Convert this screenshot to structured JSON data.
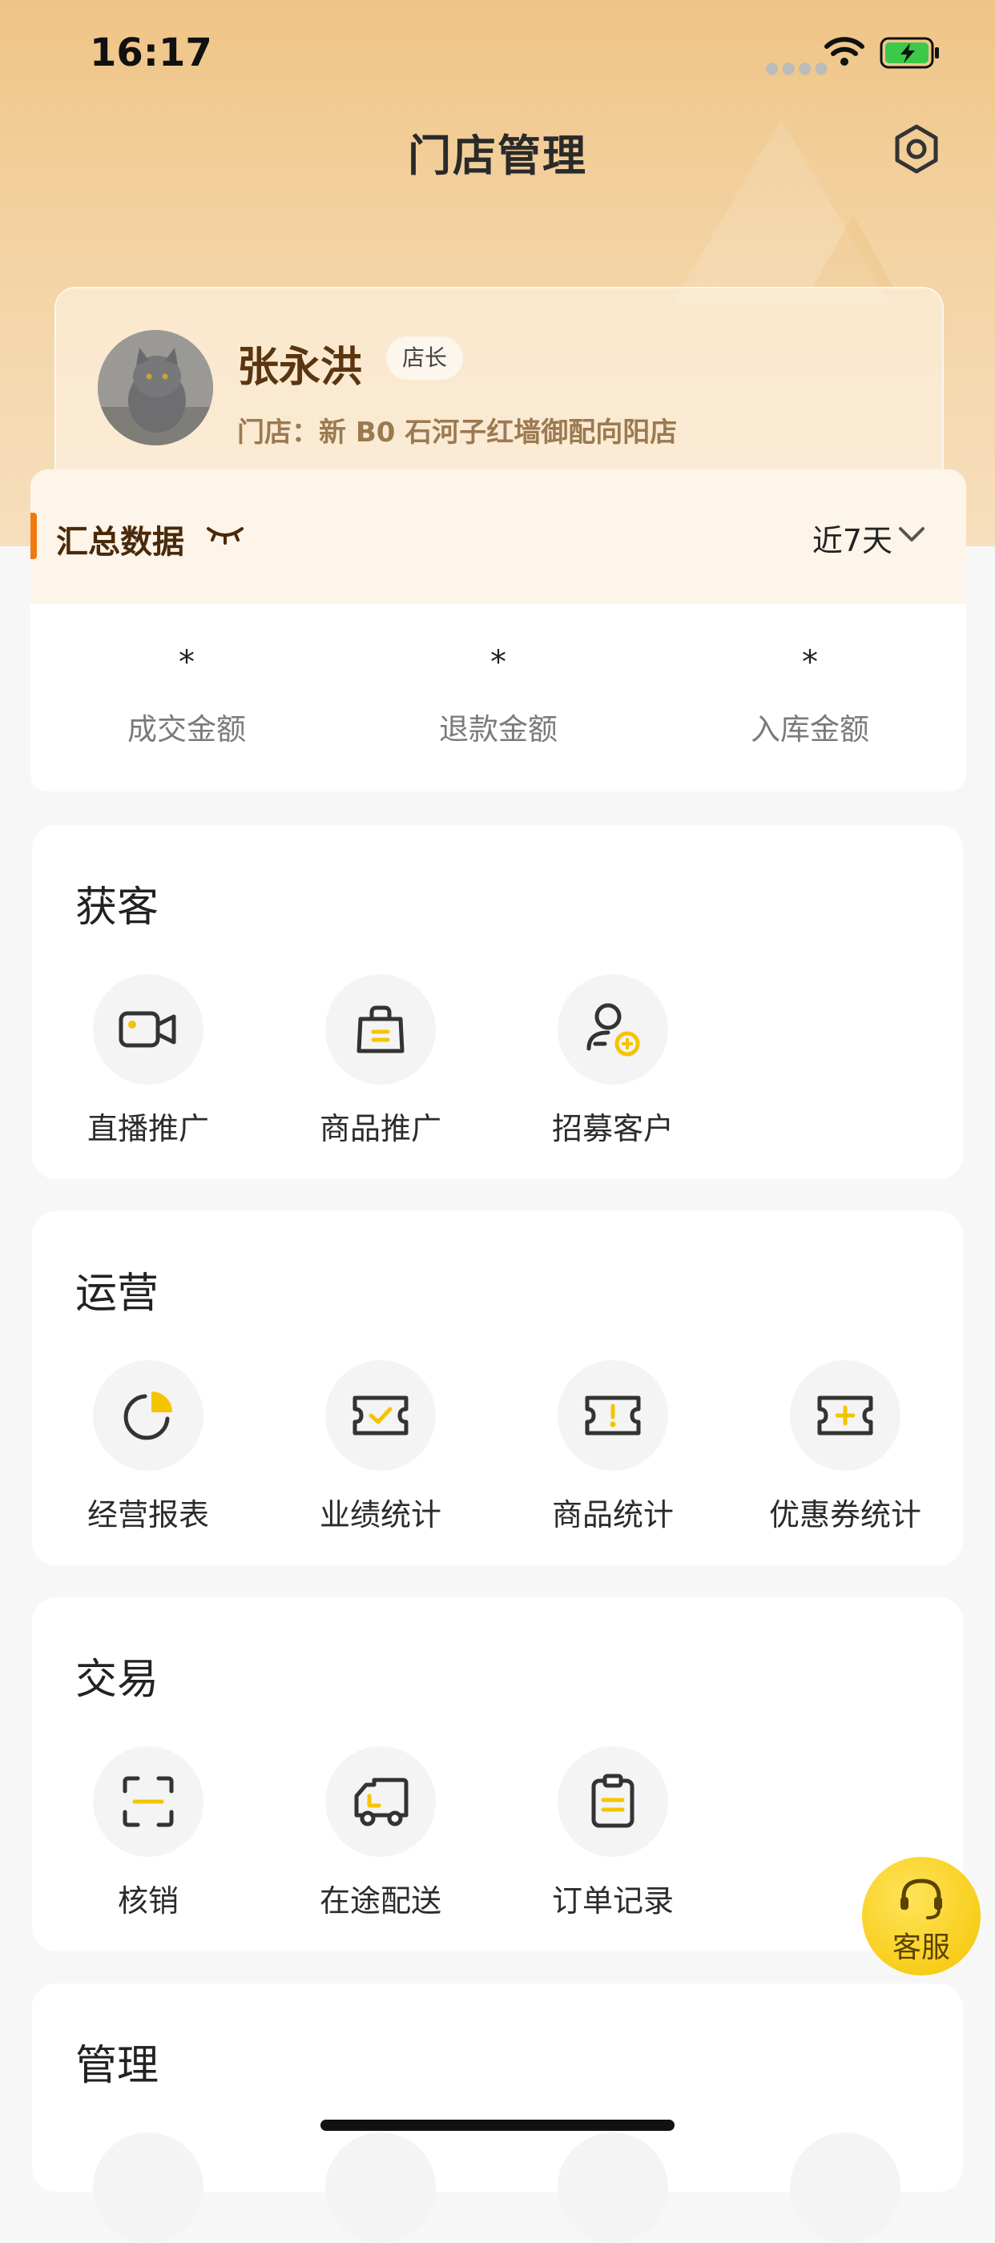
{
  "status_bar": {
    "time": "16:17"
  },
  "header": {
    "title": "门店管理"
  },
  "profile": {
    "name": "张永洪",
    "role": "店长",
    "store": "门店：新 B0 石河子红墙御配向阳店"
  },
  "summary": {
    "title": "汇总数据",
    "range": "近7天",
    "metrics": [
      {
        "value": "*",
        "label": "成交金额"
      },
      {
        "value": "*",
        "label": "退款金额"
      },
      {
        "value": "*",
        "label": "入库金额"
      }
    ]
  },
  "sections": {
    "acquisition": {
      "title": "获客",
      "items": [
        {
          "label": "直播推广",
          "icon": "video-camera-icon"
        },
        {
          "label": "商品推广",
          "icon": "shopping-bag-icon"
        },
        {
          "label": "招募客户",
          "icon": "user-add-icon"
        }
      ]
    },
    "operations": {
      "title": "运营",
      "items": [
        {
          "label": "经营报表",
          "icon": "pie-chart-icon"
        },
        {
          "label": "业绩统计",
          "icon": "ticket-check-icon"
        },
        {
          "label": "商品统计",
          "icon": "ticket-alert-icon"
        },
        {
          "label": "优惠券统计",
          "icon": "ticket-plus-icon"
        }
      ]
    },
    "transactions": {
      "title": "交易",
      "items": [
        {
          "label": "核销",
          "icon": "scan-icon"
        },
        {
          "label": "在途配送",
          "icon": "delivery-truck-icon"
        },
        {
          "label": "订单记录",
          "icon": "clipboard-icon"
        }
      ]
    },
    "management": {
      "title": "管理"
    }
  },
  "customer_service": {
    "label": "客服"
  },
  "colors": {
    "accent_yellow": "#f5c400",
    "accent_orange": "#f07a12",
    "icon_dark": "#333333"
  }
}
